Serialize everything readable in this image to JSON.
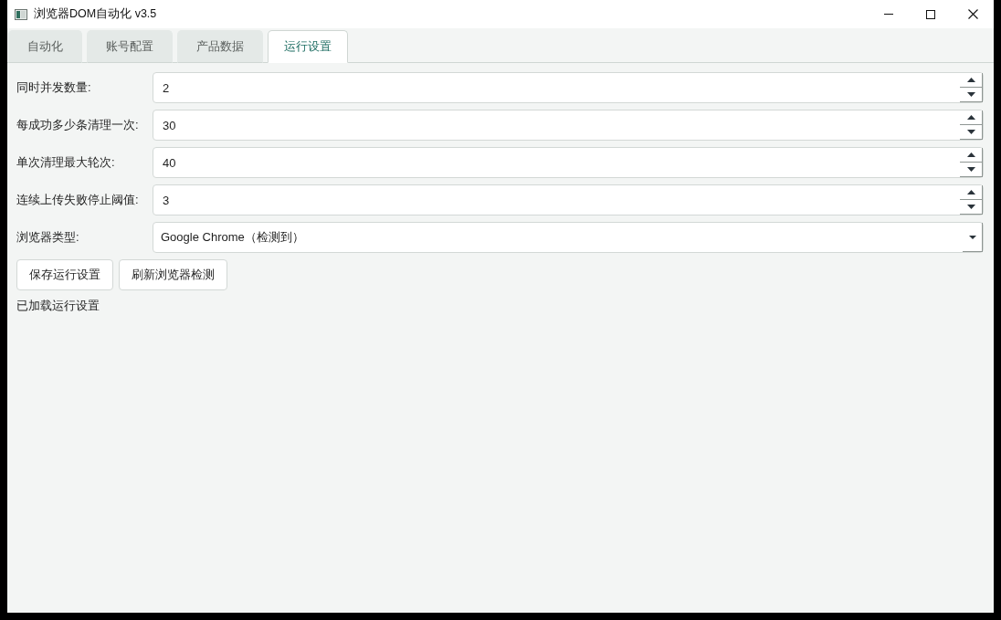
{
  "window": {
    "title": "浏览器DOM自动化 v3.5"
  },
  "tabs": [
    {
      "label": "自动化",
      "selected": false
    },
    {
      "label": "账号配置",
      "selected": false
    },
    {
      "label": "产品数据",
      "selected": false
    },
    {
      "label": "运行设置",
      "selected": true
    }
  ],
  "settings": [
    {
      "kind": "spinbox",
      "label": "同时并发数量:",
      "value": "2"
    },
    {
      "kind": "spinbox",
      "label": "每成功多少条清理一次:",
      "value": "30"
    },
    {
      "kind": "spinbox",
      "label": "单次清理最大轮次:",
      "value": "40"
    },
    {
      "kind": "spinbox",
      "label": "连续上传失败停止阈值:",
      "value": "3"
    },
    {
      "kind": "dropdown",
      "label": "浏览器类型:",
      "value": "Google Chrome（检测到）"
    }
  ],
  "buttons": [
    "保存运行设置",
    "刷新浏览器检测"
  ],
  "status": "已加载运行设置"
}
